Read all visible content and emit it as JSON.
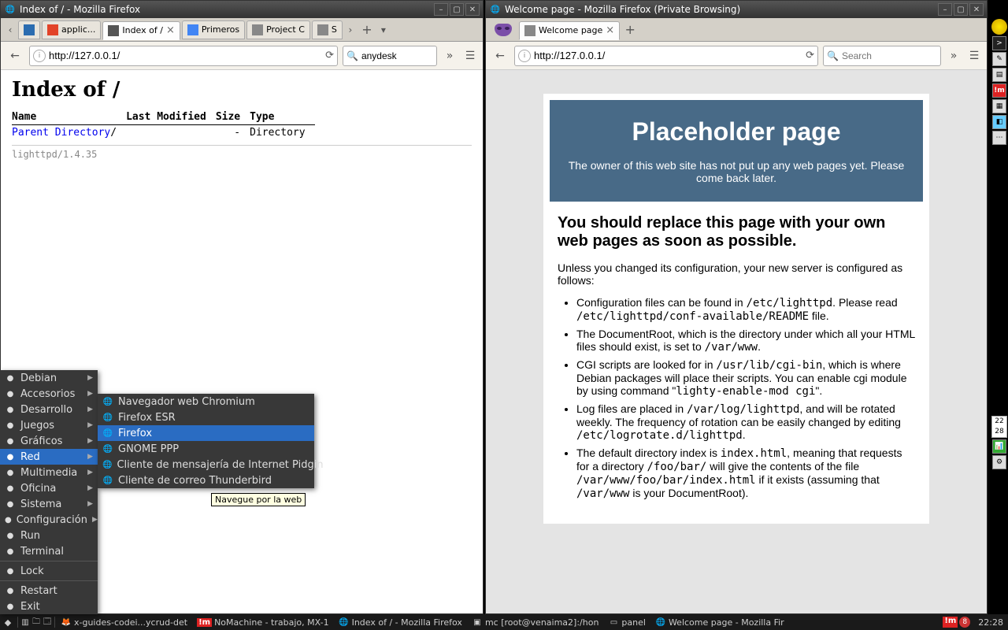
{
  "left_window": {
    "title": "Index of / - Mozilla Firefox",
    "tabs": [
      {
        "label": "",
        "favicon_color": "#2b6cb0"
      },
      {
        "label": "applic...",
        "favicon_color": "#e24329"
      },
      {
        "label": "Index of /",
        "favicon_color": "#555",
        "active": true
      },
      {
        "label": "Primeros",
        "favicon_color": "#4285f4"
      },
      {
        "label": "Project C",
        "favicon_color": "#888"
      },
      {
        "label": "S",
        "favicon_color": "#888"
      }
    ],
    "url": "http://127.0.0.1/",
    "search_value": "anydesk",
    "content": {
      "heading": "Index of /",
      "columns": [
        "Name",
        "Last Modified",
        "Size",
        "Type"
      ],
      "row": {
        "name": "Parent Directory",
        "modified": "",
        "size": "-",
        "type": "Directory"
      },
      "server": "lighttpd/1.4.35"
    }
  },
  "right_window": {
    "title": "Welcome page - Mozilla Firefox (Private Browsing)",
    "tab_label": "Welcome page",
    "url": "http://127.0.0.1/",
    "search_placeholder": "Search",
    "banner_title": "Placeholder page",
    "banner_sub": "The owner of this web site has not put up any web pages yet. Please come back later.",
    "body_h2": "You should replace this page with your own web pages as soon as possible.",
    "body_p1": "Unless you changed its configuration, your new server is configured as follows:",
    "li1a": "Configuration files can be found in ",
    "li1b": "/etc/lighttpd",
    "li1c": ". Please read ",
    "li1d": "/etc/lighttpd/conf-available/README",
    "li1e": " file.",
    "li2a": "The DocumentRoot, which is the directory under which all your HTML files should exist, is set to ",
    "li2b": "/var/www",
    "li2c": ".",
    "li3a": "CGI scripts are looked for in ",
    "li3b": "/usr/lib/cgi-bin",
    "li3c": ", which is where Debian packages will place their scripts. You can enable cgi module by using command \"",
    "li3d": "lighty-enable-mod cgi",
    "li3e": "\".",
    "li4a": "Log files are placed in ",
    "li4b": "/var/log/lighttpd",
    "li4c": ", and will be rotated weekly. The frequency of rotation can be easily changed by editing ",
    "li4d": "/etc/logrotate.d/lighttpd",
    "li4e": ".",
    "li5a": "The default directory index is ",
    "li5b": "index.html",
    "li5c": ", meaning that requests for a directory ",
    "li5d": "/foo/bar/",
    "li5e": " will give the contents of the file ",
    "li5f": "/var/www/foo/bar/index.html",
    "li5g": " if it exists (assuming that ",
    "li5h": "/var/www",
    "li5i": " is your DocumentRoot)."
  },
  "menu": {
    "main": [
      {
        "label": "Debian",
        "arrow": true
      },
      {
        "label": "Accesorios",
        "arrow": true
      },
      {
        "label": "Desarrollo",
        "arrow": true
      },
      {
        "label": "Juegos",
        "arrow": true
      },
      {
        "label": "Gráficos",
        "arrow": true
      },
      {
        "label": "Red",
        "arrow": true,
        "highlighted": true
      },
      {
        "label": "Multimedia",
        "arrow": true
      },
      {
        "label": "Oficina",
        "arrow": true
      },
      {
        "label": "Sistema",
        "arrow": true
      },
      {
        "label": "Configuración",
        "arrow": true
      },
      {
        "label": "Run"
      },
      {
        "label": "Terminal"
      },
      {
        "sep": true
      },
      {
        "label": "Lock"
      },
      {
        "sep": true
      },
      {
        "label": "Restart"
      },
      {
        "label": "Exit"
      }
    ],
    "submenu": [
      {
        "label": "Navegador web Chromium"
      },
      {
        "label": "Firefox ESR"
      },
      {
        "label": "Firefox",
        "highlighted": true
      },
      {
        "label": "GNOME PPP"
      },
      {
        "label": "Cliente de mensajería de Internet Pidgin"
      },
      {
        "label": "Cliente de correo Thunderbird"
      }
    ],
    "tooltip": "Navegue por la web"
  },
  "taskbar": {
    "items": [
      {
        "label": "x-guides-codei...ycrud-det",
        "icon": "🦊"
      },
      {
        "label": "NoMachine - trabajo, MX-1",
        "icon": "!m",
        "red": true
      },
      {
        "label": "Index of / - Mozilla Firefox",
        "icon": "🌐"
      },
      {
        "label": "mc [root@venaima2]:/hon",
        "icon": "▣"
      },
      {
        "label": "panel",
        "icon": "▭"
      },
      {
        "label": "Welcome page - Mozilla Fir",
        "icon": "🌐"
      }
    ],
    "tray_nm": "!m",
    "tray_badge": "8",
    "clock": "22:28",
    "side_nums": [
      "22",
      "28"
    ]
  }
}
